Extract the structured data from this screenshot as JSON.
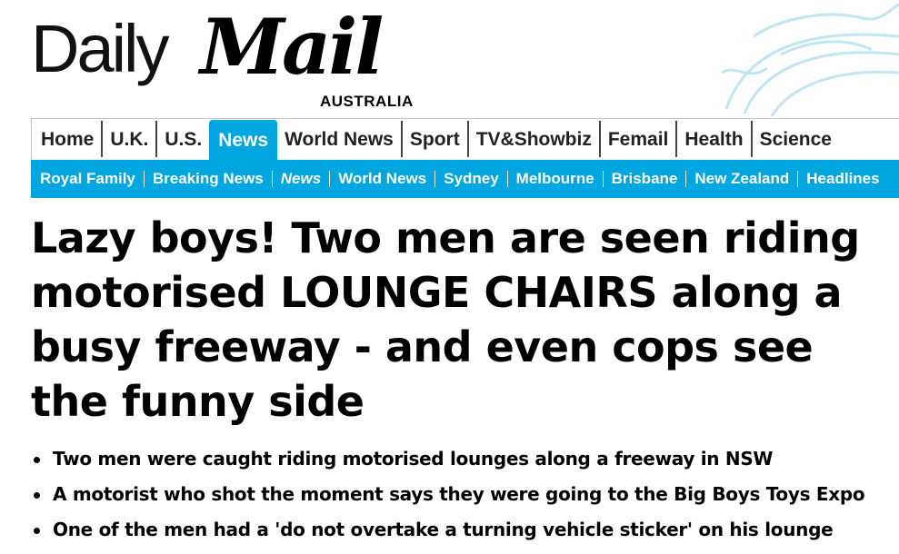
{
  "logo": {
    "daily": "Daily",
    "mail": "Mail",
    "region": "AUSTRALIA"
  },
  "nav_primary": [
    {
      "label": "Home"
    },
    {
      "label": "U.K."
    },
    {
      "label": "U.S."
    },
    {
      "label": "News",
      "active": true
    },
    {
      "label": "World News"
    },
    {
      "label": "Sport"
    },
    {
      "label": "TV&Showbiz"
    },
    {
      "label": "Femail"
    },
    {
      "label": "Health"
    },
    {
      "label": "Science"
    }
  ],
  "nav_secondary": [
    {
      "label": "Royal Family"
    },
    {
      "label": "Breaking News"
    },
    {
      "label": "News",
      "italic": true
    },
    {
      "label": "World News"
    },
    {
      "label": "Sydney"
    },
    {
      "label": "Melbourne"
    },
    {
      "label": "Brisbane"
    },
    {
      "label": "New Zealand"
    },
    {
      "label": "Headlines"
    }
  ],
  "article": {
    "headline": "Lazy boys! Two men are seen riding motorised LOUNGE CHAIRS along a busy freeway - and even cops see the funny side",
    "bullets": [
      "Two men were caught riding motorised lounges along a freeway in NSW",
      "A motorist who shot the moment says they were going to the Big Boys Toys Expo",
      "One of the men had a 'do not overtake a turning vehicle sticker' on his lounge"
    ]
  },
  "colors": {
    "accent": "#00a6e0",
    "text": "#000000",
    "decoration": "#bfe6f5"
  }
}
